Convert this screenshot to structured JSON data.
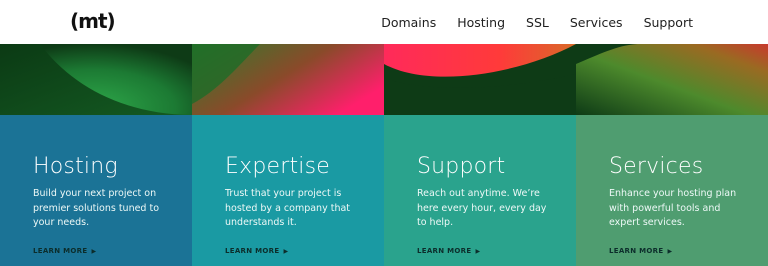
{
  "header": {
    "logo": "(mt)",
    "nav": [
      "Domains",
      "Hosting",
      "SSL",
      "Services",
      "Support"
    ]
  },
  "cards": [
    {
      "title": "Hosting",
      "desc": "Build your next project on premier solutions tuned to your needs.",
      "link": "LEARN MORE"
    },
    {
      "title": "Expertise",
      "desc": "Trust that your project is hosted by a company that understands it.",
      "link": "LEARN MORE"
    },
    {
      "title": "Support",
      "desc": "Reach out anytime. We’re here every hour, every day to help.",
      "link": "LEARN MORE"
    },
    {
      "title": "Services",
      "desc": "Enhance your hosting plan with powerful tools and expert services.",
      "link": "LEARN MORE"
    }
  ],
  "colors": {
    "card_1": "#1b7396",
    "card_2": "#1a9aa3",
    "card_3": "#2aa38d",
    "card_4": "#4f9d70",
    "banner_dark": "#0e3b16",
    "accent_pink": "#ff2a5a"
  },
  "icons": {
    "link_arrow": "triangle-right-icon"
  }
}
